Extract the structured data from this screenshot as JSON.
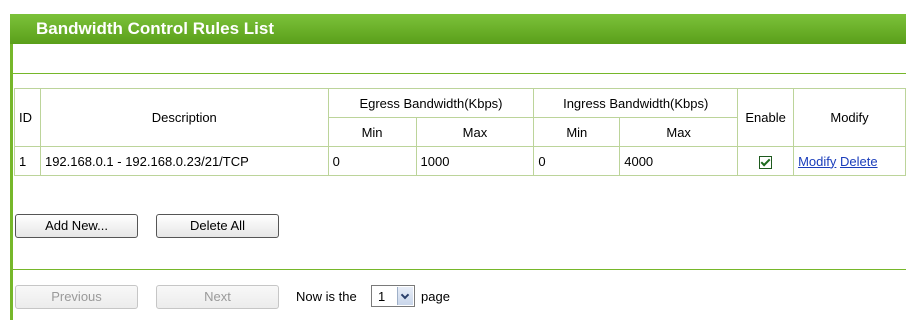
{
  "panel": {
    "title": "Bandwidth Control Rules List"
  },
  "table": {
    "headers": {
      "id": "ID",
      "description": "Description",
      "egress": "Egress Bandwidth(Kbps)",
      "ingress": "Ingress Bandwidth(Kbps)",
      "enable": "Enable",
      "modify": "Modify",
      "min": "Min",
      "max": "Max"
    },
    "rows": [
      {
        "id": "1",
        "description": "192.168.0.1 - 192.168.0.23/21/TCP",
        "egress_min": "0",
        "egress_max": "1000",
        "ingress_min": "0",
        "ingress_max": "4000",
        "enabled": true,
        "modify_label": "Modify",
        "delete_label": "Delete"
      }
    ]
  },
  "actions": {
    "add_new": "Add New...",
    "delete_all": "Delete All"
  },
  "pager": {
    "previous": "Previous",
    "next": "Next",
    "prefix": "Now is the",
    "current_page": "1",
    "suffix": "page"
  }
}
